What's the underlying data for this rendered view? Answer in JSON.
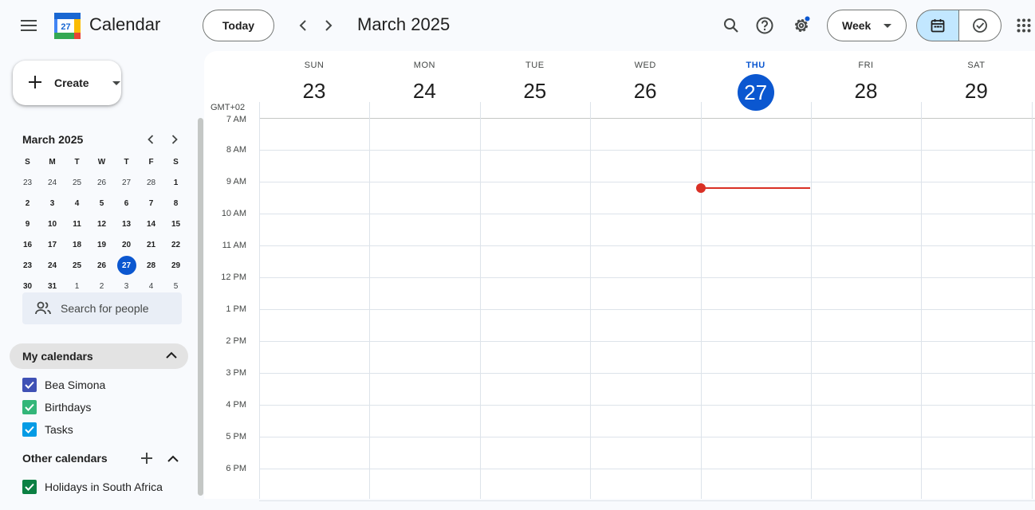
{
  "app": {
    "name": "Calendar",
    "logo_day": "27"
  },
  "header": {
    "today_label": "Today",
    "title": "March 2025",
    "view_label": "Week",
    "icons": [
      "main-menu-icon",
      "search-icon",
      "help-icon",
      "settings-icon",
      "calendar-view-icon",
      "tasks-view-icon",
      "apps-grid-icon"
    ]
  },
  "sidebar": {
    "create_label": "Create",
    "mini_calendar": {
      "title": "March 2025",
      "weekdays": [
        "S",
        "M",
        "T",
        "W",
        "T",
        "F",
        "S"
      ],
      "weeks": [
        [
          "23",
          "24",
          "25",
          "26",
          "27",
          "28",
          "1"
        ],
        [
          "2",
          "3",
          "4",
          "5",
          "6",
          "7",
          "8"
        ],
        [
          "9",
          "10",
          "11",
          "12",
          "13",
          "14",
          "15"
        ],
        [
          "16",
          "17",
          "18",
          "19",
          "20",
          "21",
          "22"
        ],
        [
          "23",
          "24",
          "25",
          "26",
          "27",
          "28",
          "29"
        ],
        [
          "30",
          "31",
          "1",
          "2",
          "3",
          "4",
          "5"
        ]
      ],
      "today": "27"
    },
    "search_people_placeholder": "Search for people",
    "my_calendars_label": "My calendars",
    "my_calendars": [
      {
        "label": "Bea Simona",
        "color": "#3f51b5"
      },
      {
        "label": "Birthdays",
        "color": "#33b679"
      },
      {
        "label": "Tasks",
        "color": "#039be5"
      }
    ],
    "other_calendars_label": "Other calendars",
    "other_calendars": [
      {
        "label": "Holidays in South Africa",
        "color": "#0b8043"
      }
    ]
  },
  "week": {
    "timezone": "GMT+02",
    "days": [
      {
        "name": "SUN",
        "date": "23"
      },
      {
        "name": "MON",
        "date": "24"
      },
      {
        "name": "TUE",
        "date": "25"
      },
      {
        "name": "WED",
        "date": "26"
      },
      {
        "name": "THU",
        "date": "27",
        "today": true
      },
      {
        "name": "FRI",
        "date": "28"
      },
      {
        "name": "SAT",
        "date": "29"
      }
    ],
    "hours": [
      "7 AM",
      "8 AM",
      "9 AM",
      "10 AM",
      "11 AM",
      "12 PM",
      "1 PM",
      "2 PM",
      "3 PM",
      "4 PM",
      "5 PM",
      "6 PM"
    ]
  },
  "colors": {
    "accent": "#0b57d0",
    "now_indicator": "#d93025",
    "selected_view": "#c2e7ff"
  }
}
